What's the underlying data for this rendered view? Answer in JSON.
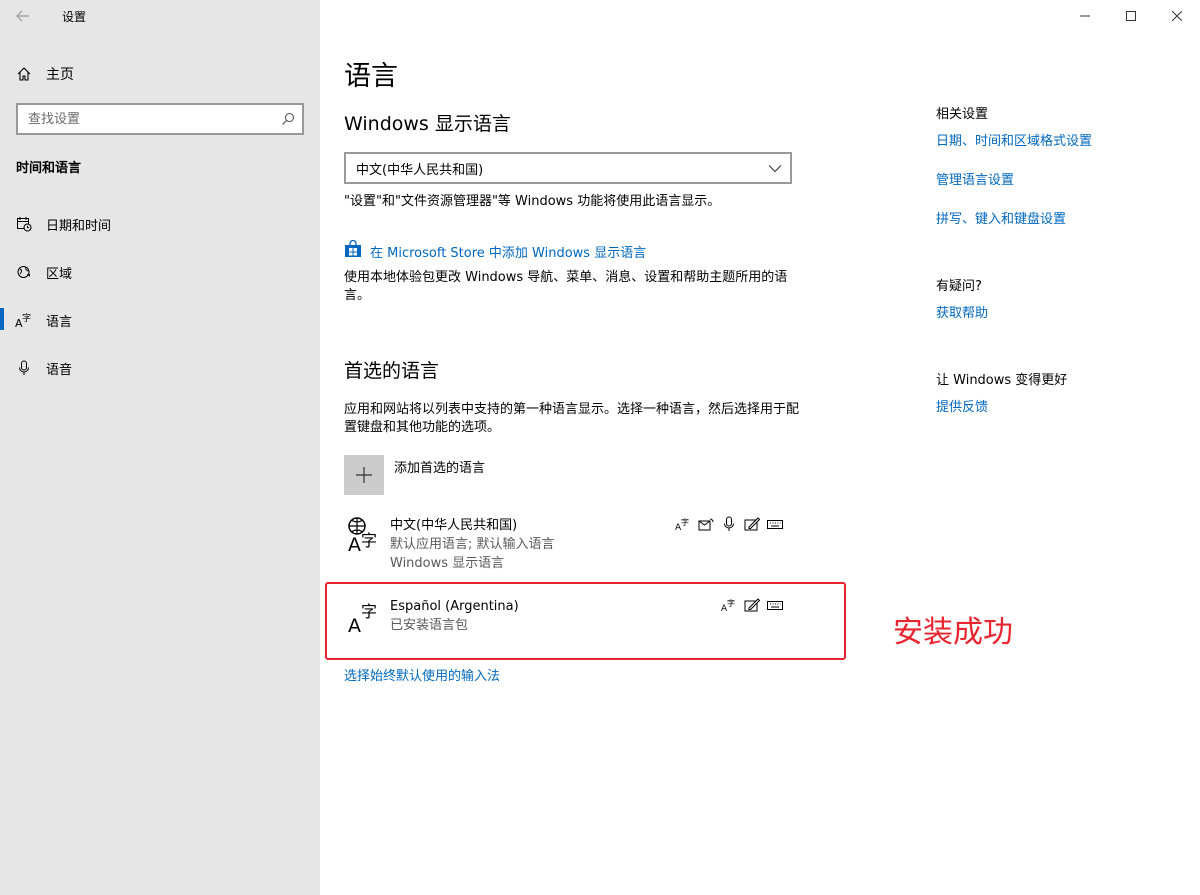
{
  "window": {
    "title": "设置",
    "controls": [
      "minimize-icon",
      "maximize-icon",
      "close-icon"
    ]
  },
  "sidebar": {
    "home_label": "主页",
    "search_placeholder": "查找设置",
    "section_title": "时间和语言",
    "items": [
      {
        "label": "日期和时间",
        "icon": "calendar-clock-icon"
      },
      {
        "label": "区域",
        "icon": "globe-region-icon"
      },
      {
        "label": "语言",
        "icon": "language-icon",
        "active": true
      },
      {
        "label": "语音",
        "icon": "microphone-icon"
      }
    ]
  },
  "main": {
    "title": "语言",
    "display_language": {
      "heading": "Windows 显示语言",
      "selected": "中文(中华人民共和国)",
      "note": "\"设置\"和\"文件资源管理器\"等 Windows 功能将使用此语言显示。",
      "store_link": "在 Microsoft Store 中添加 Windows 显示语言",
      "store_desc": "使用本地体验包更改 Windows 导航、菜单、消息、设置和帮助主题所用的语言。"
    },
    "preferred": {
      "heading": "首选的语言",
      "desc": "应用和网站将以列表中支持的第一种语言显示。选择一种语言，然后选择用于配置键盘和其他功能的选项。",
      "add_label": "添加首选的语言",
      "languages": [
        {
          "name": "中文(中华人民共和国)",
          "sub1": "默认应用语言; 默认输入语言",
          "sub2": "Windows 显示语言",
          "features": [
            "display-language-icon",
            "text-to-speech-icon",
            "speech-recognition-icon",
            "handwriting-icon",
            "keyboard-icon"
          ]
        },
        {
          "name": "Español (Argentina)",
          "sub1": "已安装语言包",
          "features": [
            "display-language-icon",
            "handwriting-icon",
            "keyboard-icon"
          ]
        }
      ],
      "input_method_link": "选择始终默认使用的输入法"
    },
    "annotation": "安装成功"
  },
  "related": {
    "heading": "相关设置",
    "links": [
      "日期、时间和区域格式设置",
      "管理语言设置",
      "拼写、键入和键盘设置"
    ],
    "help_heading": "有疑问?",
    "help_link": "获取帮助",
    "feedback_heading": "让 Windows 变得更好",
    "feedback_link": "提供反馈"
  },
  "colors": {
    "accent": "#0067c0",
    "sidebar_bg": "#e6e6e6",
    "annotation": "#e8242e"
  }
}
